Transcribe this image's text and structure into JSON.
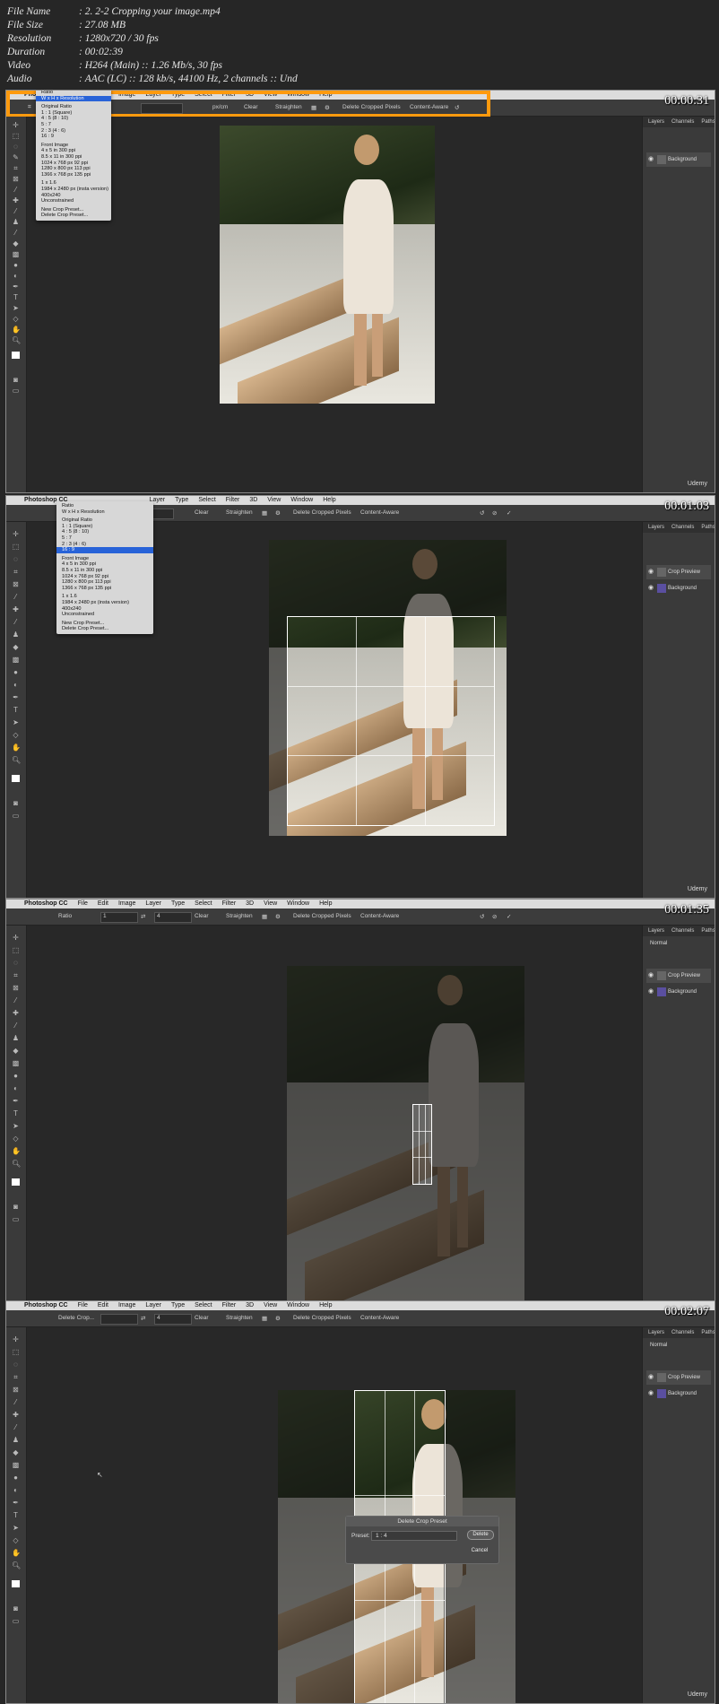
{
  "info": [
    {
      "key": "File Name",
      "value": "2. 2-2 Cropping your image.mp4"
    },
    {
      "key": "File Size",
      "value": "27.08 MB"
    },
    {
      "key": "Resolution",
      "value": "1280x720 / 30 fps"
    },
    {
      "key": "Duration",
      "value": "00:02:39"
    },
    {
      "key": "Video",
      "value": "H264 (Main) :: 1.26 Mb/s, 30 fps"
    },
    {
      "key": "Audio",
      "value": "AAC (LC) :: 128 kb/s, 44100 Hz, 2 channels :: Und"
    }
  ],
  "menu": [
    "Photoshop CC",
    "File",
    "Edit",
    "Image",
    "Layer",
    "Type",
    "Select",
    "Filter",
    "3D",
    "View",
    "Window",
    "Help"
  ],
  "options": {
    "clear": "Clear",
    "straighten": "Straighten",
    "delete_cropped": "Delete Cropped Pixels",
    "content_aware": "Content-Aware",
    "ratio": "Ratio",
    "px_cm": "px/cm",
    "one": "1",
    "four": "4",
    "delete_crop": "Delete Crop..."
  },
  "panel": {
    "layers": "Layers",
    "channels": "Channels",
    "paths": "Paths",
    "normal": "Normal",
    "crop_preview": "Crop Preview",
    "background": "Background"
  },
  "dropdown1": [
    "Ratio",
    "W x H x Resolution",
    "",
    "Original Ratio",
    "1 : 1 (Square)",
    "4 : 5 (8 : 10)",
    "5 : 7",
    "2 : 3 (4 : 6)",
    "16 : 9",
    "",
    "Front Image",
    "4 x 5 in 300 ppi",
    "8.5 x 11 in 300 ppi",
    "1024 x 768 px 92 ppi",
    "1280 x 800 px 113 ppi",
    "1366 x 768 px 135 ppi",
    "",
    "1 x 1.6",
    "1984 x 2480 px (insta version)",
    "400x240",
    "Unconstrained",
    "",
    "New Crop Preset...",
    "Delete Crop Preset..."
  ],
  "dropdown2": [
    "Ratio",
    "W x H x Resolution",
    "",
    "Original Ratio",
    "1 : 1 (Square)",
    "4 : 5 (8 : 10)",
    "5 : 7",
    "2 : 3 (4 : 6)",
    "16 : 9",
    "",
    "Front Image",
    "4 x 5 in 300 ppi",
    "8.5 x 11 in 300 ppi",
    "1024 x 768 px 92 ppi",
    "1280 x 800 px 113 ppi",
    "1366 x 768 px 135 ppi",
    "",
    "1 x 1.6",
    "1984 x 2480 px (insta version)",
    "400x240",
    "Unconstrained",
    "",
    "New Crop Preset...",
    "Delete Crop Preset..."
  ],
  "timecodes": [
    "00:00:31",
    "00:01:03",
    "00:01:35",
    "00:02:07"
  ],
  "udemy": "Udemy",
  "dialog": {
    "title": "Delete Crop Preset",
    "preset_label": "Preset:",
    "preset_value": "1 : 4",
    "delete": "Delete",
    "cancel": "Cancel"
  }
}
